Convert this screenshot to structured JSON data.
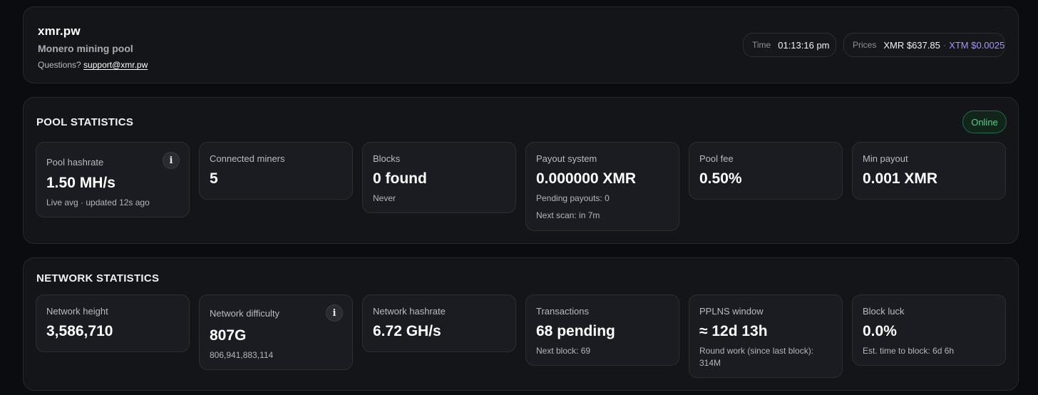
{
  "header": {
    "title": "xmr.pw",
    "subtitle": "Monero mining pool",
    "questions_label": "Questions?",
    "support_email": "support@xmr.pw",
    "time_label": "Time",
    "time_value": "01:13:16 pm",
    "prices_label": "Prices",
    "xmr_price": "XMR $637.85",
    "price_separator": "·",
    "xtm_price": "XTM $0.0025"
  },
  "pool": {
    "title": "POOL STATISTICS",
    "status": "Online",
    "cards": {
      "hashrate": {
        "label": "Pool hashrate",
        "value": "1.50 MH/s",
        "sub": "Live avg · updated 12s ago",
        "icon": "info-icon"
      },
      "miners": {
        "label": "Connected miners",
        "value": "5"
      },
      "blocks": {
        "label": "Blocks",
        "value": "0 found",
        "sub": "Never"
      },
      "payout": {
        "label": "Payout system",
        "value": "0.000000 XMR",
        "sub1": "Pending payouts: 0",
        "sub2": "Next scan: in 7m"
      },
      "fee": {
        "label": "Pool fee",
        "value": "0.50%"
      },
      "min_payout": {
        "label": "Min payout",
        "value": "0.001 XMR"
      }
    }
  },
  "network": {
    "title": "NETWORK STATISTICS",
    "cards": {
      "height": {
        "label": "Network height",
        "value": "3,586,710"
      },
      "difficulty": {
        "label": "Network difficulty",
        "value": "807G",
        "sub": "806,941,883,114",
        "icon": "info-icon"
      },
      "hashrate": {
        "label": "Network hashrate",
        "value": "6.72 GH/s"
      },
      "transactions": {
        "label": "Transactions",
        "value": "68 pending",
        "sub": "Next block: 69"
      },
      "pplns": {
        "label": "PPLNS window",
        "value": "≈ 12d 13h",
        "sub1": "Round work (since last block):",
        "sub2": "314M"
      },
      "luck": {
        "label": "Block luck",
        "value": "0.0%",
        "sub": "Est. time to block: 6d 6h"
      }
    }
  },
  "colors": {
    "background": "#0b0c0f",
    "panel": "#141519",
    "card": "#1b1c21",
    "online_green": "#4bd38a",
    "xtm_purple": "#a892ff"
  }
}
